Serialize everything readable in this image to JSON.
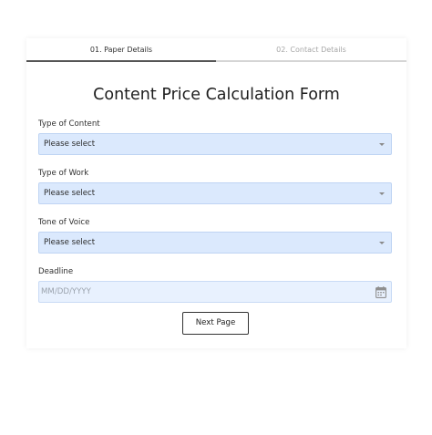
{
  "steps": [
    {
      "label": "01. Paper Details",
      "active": true
    },
    {
      "label": "02. Contact Details",
      "active": false
    }
  ],
  "form": {
    "title": "Content Price Calculation Form",
    "fields": [
      {
        "label": "Type of Content",
        "value": "Please select",
        "kind": "select"
      },
      {
        "label": "Type of Work",
        "value": "Please select",
        "kind": "select"
      },
      {
        "label": "Tone of Voice",
        "value": "Please select",
        "kind": "select"
      },
      {
        "label": "Deadline",
        "placeholder": "MM/DD/YYYY",
        "kind": "date"
      }
    ],
    "next_button": "Next Page"
  },
  "colors": {
    "field_bg": "#dbe9fd",
    "field_border": "#bfd4f3",
    "active_step": "#555555",
    "inactive_step": "#d5d5d5"
  },
  "icons": [
    "chevron-down-icon",
    "calendar-icon"
  ]
}
